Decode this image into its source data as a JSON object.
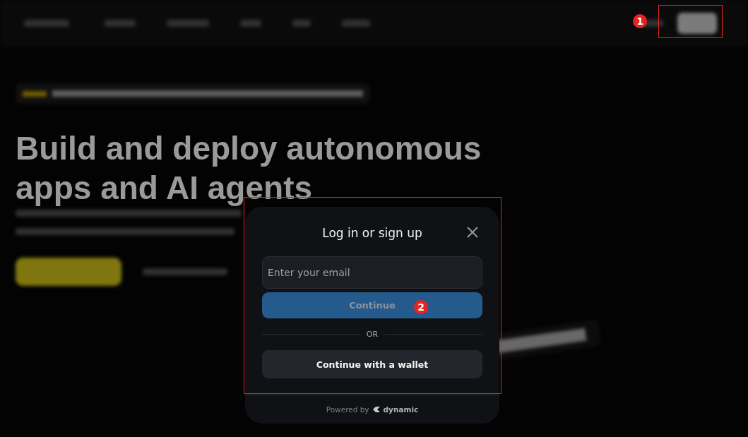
{
  "background_page": {
    "headline": "Build and deploy autonomous apps and AI agents"
  },
  "dialog": {
    "title": "Log in or sign up",
    "email": {
      "placeholder": "Enter your email"
    },
    "continue_button": {
      "label": "Continue",
      "disabled": true
    },
    "divider": "OR",
    "wallet_button": "Continue with a wallet",
    "footer": {
      "prefix": "Powered by",
      "brand": "dynamic"
    }
  },
  "annotations": [
    {
      "label": "1"
    },
    {
      "label": "2"
    }
  ]
}
